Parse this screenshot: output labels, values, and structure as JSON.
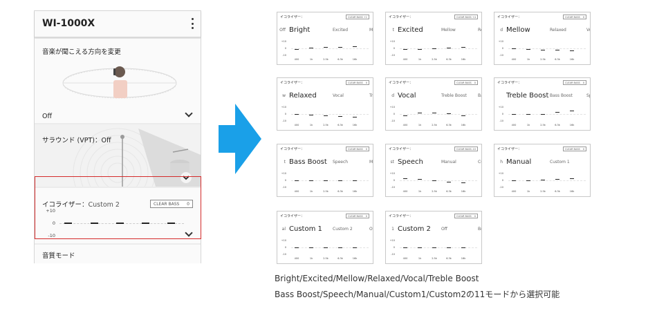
{
  "phone": {
    "title": "WI-1000X",
    "menu_icon": "more-vert-icon",
    "direction": {
      "label": "音楽が聞こえる方向を変更",
      "value": "Off"
    },
    "surround": {
      "label": "サラウンド (VPT)：Off"
    },
    "equalizer": {
      "label": "イコライザー：",
      "preset": "Custom 2",
      "clear_bass_label": "CLEAR BASS",
      "clear_bass_value": "0",
      "ticks": [
        "+10",
        "0",
        "-10"
      ],
      "bands_db": [
        0,
        0,
        0,
        0,
        0
      ]
    },
    "sound_mode": {
      "label": "音質モード"
    }
  },
  "arrow_color": "#1aa0e8",
  "highlight_color": "#d42a2a",
  "preset_common": {
    "eq_label": "イコライザー：",
    "clear_bass_label": "CLEAR BASS",
    "ticks": [
      "+10",
      "0",
      "-10"
    ],
    "freqs": [
      "400",
      "1k",
      "2.5k",
      "6.3k",
      "16k"
    ]
  },
  "presets": [
    {
      "prev": "Off",
      "name": "Bright",
      "next": "Excited",
      "next2": "M",
      "clear_bass": "+1",
      "bands_db": [
        -1,
        1,
        2,
        2,
        3
      ]
    },
    {
      "prev": "t",
      "name": "Excited",
      "next": "Mellow",
      "next2": "Re",
      "clear_bass": "+4",
      "bands_db": [
        -1,
        -1,
        0,
        1,
        2
      ]
    },
    {
      "prev": "d",
      "name": "Mellow",
      "next": "Relaxed",
      "next2": "Vo",
      "clear_bass": "0",
      "bands_db": [
        0,
        -1,
        -2,
        -2,
        -3
      ]
    },
    {
      "prev": "w",
      "name": "Relaxed",
      "next": "Vocal",
      "next2": "Tr",
      "clear_bass": "0",
      "bands_db": [
        0,
        -1,
        -2,
        -3,
        -4
      ]
    },
    {
      "prev": "d",
      "name": "Vocal",
      "next": "Treble Boost",
      "next2": "Ba",
      "clear_bass": "0",
      "bands_db": [
        -2,
        2,
        2,
        1,
        -2
      ]
    },
    {
      "prev": "",
      "name": "Treble Boost",
      "next": "Bass Boost",
      "next2": "Sp",
      "clear_bass": "0",
      "bands_db": [
        0,
        0,
        0,
        3,
        5
      ]
    },
    {
      "prev": "t",
      "name": "Bass Boost",
      "next": "Speech",
      "next2": "Ma",
      "clear_bass": "0",
      "bands_db": [
        0,
        0,
        0,
        0,
        0
      ]
    },
    {
      "prev": "st",
      "name": "Speech",
      "next": "Manual",
      "next2": "Cu",
      "clear_bass": "-10",
      "bands_db": [
        3,
        2,
        0,
        -2,
        -3
      ]
    },
    {
      "prev": "h",
      "name": "Manual",
      "next": "Custom 1",
      "next2": "",
      "clear_bass": "0",
      "bands_db": [
        0,
        0,
        1,
        2,
        3
      ]
    },
    {
      "prev": "al",
      "name": "Custom 1",
      "next": "Custom 2",
      "next2": "Of",
      "clear_bass": "0",
      "bands_db": [
        0,
        0,
        0,
        0,
        0
      ]
    },
    {
      "prev": "1",
      "name": "Custom 2",
      "next": "Off",
      "next2": "Bri",
      "clear_bass": "0",
      "bands_db": [
        0,
        0,
        0,
        0,
        0
      ]
    }
  ],
  "caption": {
    "line1": "Bright/Excited/Mellow/Relaxed/Vocal/Treble Boost",
    "line2": "Bass Boost/Speech/Manual/Custom1/Custom2の11モードから選択可能"
  }
}
